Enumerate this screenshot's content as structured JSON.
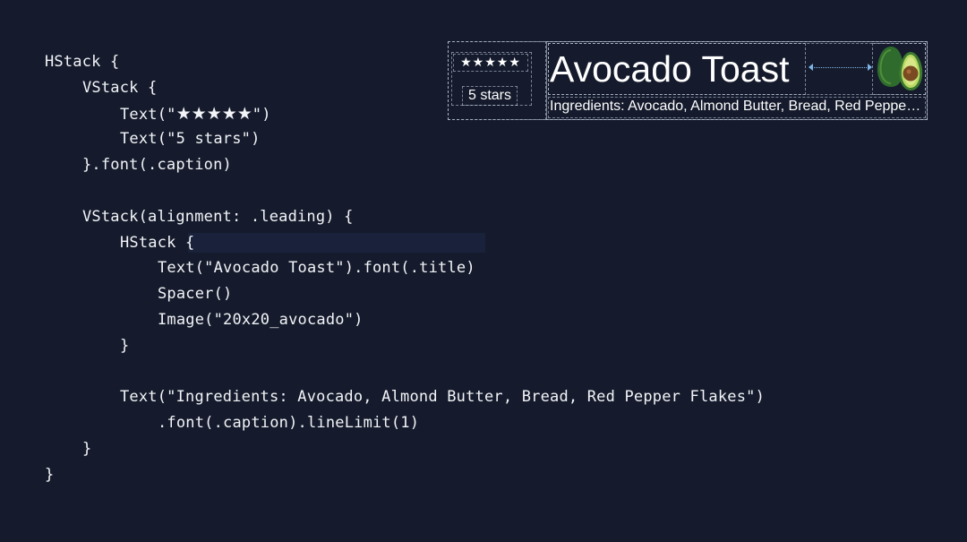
{
  "code": {
    "lines": [
      "HStack {",
      "VStack {",
      "Text(\"",
      "\")",
      "Text(\"5 stars\")",
      "}.font(.caption)",
      "VStack(alignment: .leading) {",
      "HStack {",
      "Text(\"Avocado Toast\").font(.title)",
      "Spacer()",
      "Image(\"20x20_avocado\")",
      "}",
      "Text(\"Ingredients: Avocado, Almond Butter, Bread, Red Pepper Flakes\")",
      ".font(.caption).lineLimit(1)",
      "}",
      "}"
    ],
    "stars": "★★★★★"
  },
  "preview": {
    "stars": "★★★★★",
    "rating_text": "5 stars",
    "title": "Avocado Toast",
    "ingredients": "Ingredients: Avocado, Almond Butter, Bread, Red Pepper Flakes",
    "image_icon": "avocado-icon"
  },
  "colors": {
    "background": "#151b2c",
    "text": "#f2f4f8",
    "guide": "#cdd7eb",
    "spacer_arrow": "#7fb5e8",
    "avocado_dark": "#2f6b2d",
    "avocado_light": "#8fbf4a",
    "avocado_pit": "#7a4a22"
  }
}
